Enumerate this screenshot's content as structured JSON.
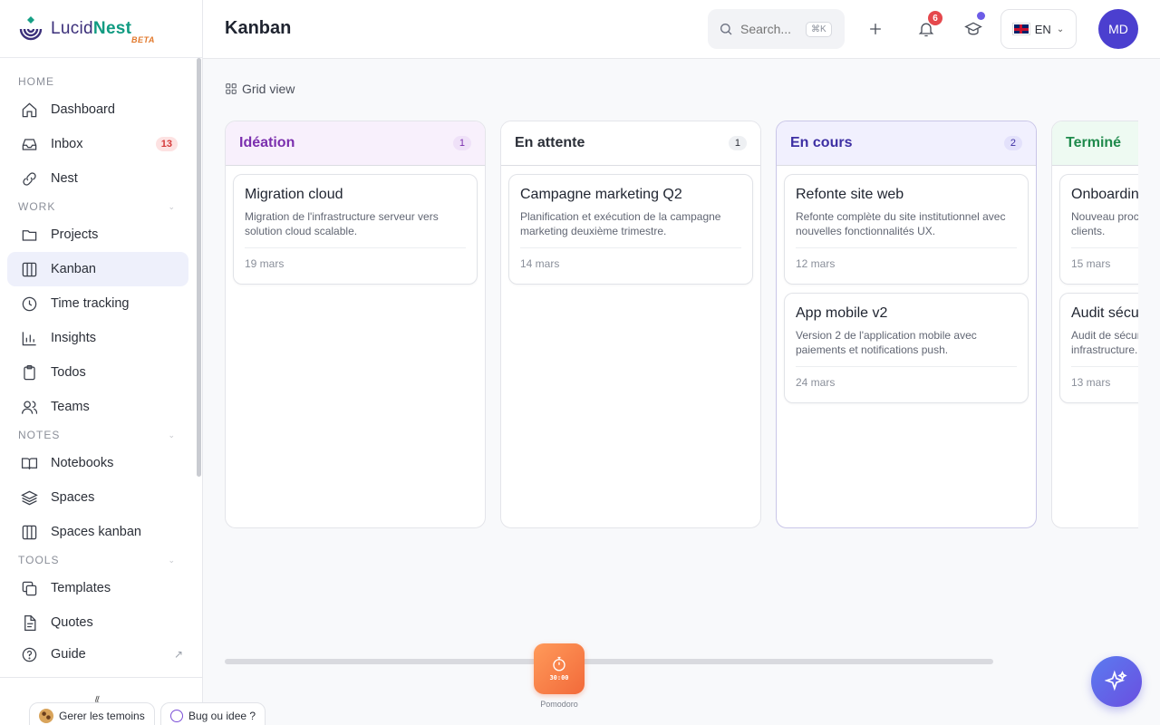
{
  "app": {
    "name_part1": "Lucid",
    "name_part2": "Nest",
    "beta": "BETA"
  },
  "header": {
    "title": "Kanban",
    "search_placeholder": "Search...",
    "search_shortcut": "⌘K",
    "notification_count": "6",
    "language": "EN",
    "avatar_initials": "MD"
  },
  "sidebar": {
    "sections": [
      {
        "label": "HOME"
      },
      {
        "label": "WORK"
      },
      {
        "label": "NOTES"
      },
      {
        "label": "TOOLS"
      }
    ],
    "items": [
      {
        "label": "Dashboard",
        "icon": "home-icon"
      },
      {
        "label": "Inbox",
        "icon": "inbox-icon",
        "badge": "13"
      },
      {
        "label": "Nest",
        "icon": "link-icon"
      },
      {
        "label": "Projects",
        "icon": "folder-icon"
      },
      {
        "label": "Kanban",
        "icon": "kanban-icon",
        "active": true
      },
      {
        "label": "Time tracking",
        "icon": "clock-icon"
      },
      {
        "label": "Insights",
        "icon": "chart-icon"
      },
      {
        "label": "Todos",
        "icon": "clipboard-icon"
      },
      {
        "label": "Teams",
        "icon": "users-icon"
      },
      {
        "label": "Notebooks",
        "icon": "book-icon"
      },
      {
        "label": "Spaces",
        "icon": "layers-icon"
      },
      {
        "label": "Spaces kanban",
        "icon": "kanban-icon"
      },
      {
        "label": "Templates",
        "icon": "copy-icon"
      },
      {
        "label": "Quotes",
        "icon": "file-icon"
      },
      {
        "label": "Guide",
        "icon": "help-icon"
      }
    ]
  },
  "main": {
    "view_toggle": "Grid view",
    "columns": [
      {
        "title": "Idéation",
        "count": "1",
        "color": "#7b2fae",
        "bg": "#f8f0fc",
        "count_bg": "#efe1f8",
        "cards": [
          {
            "title": "Migration cloud",
            "desc": "Migration de l'infrastructure serveur vers solution cloud scalable.",
            "date": "19 mars"
          }
        ]
      },
      {
        "title": "En attente",
        "count": "1",
        "color": "#2b2f38",
        "bg": "#ffffff",
        "count_bg": "#eef0f3",
        "cards": [
          {
            "title": "Campagne marketing Q2",
            "desc": "Planification et exécution de la campagne marketing deuxième trimestre.",
            "date": "14 mars"
          }
        ]
      },
      {
        "title": "En cours",
        "count": "2",
        "color": "#3d2fa3",
        "bg": "#f1f0fe",
        "count_bg": "#e3e1fb",
        "cards": [
          {
            "title": "Refonte site web",
            "desc": "Refonte complète du site institutionnel avec nouvelles fonctionnalités UX.",
            "date": "12 mars"
          },
          {
            "title": "App mobile v2",
            "desc": "Version 2 de l'application mobile avec paiements et notifications push.",
            "date": "24 mars"
          }
        ]
      },
      {
        "title": "Terminé",
        "count": "",
        "color": "#1f8a4c",
        "bg": "#eefaf2",
        "count_bg": "#dff3e6",
        "cards": [
          {
            "title": "Onboarding",
            "desc": "Nouveau processus pour les nouveaux clients.",
            "date": "15 mars"
          },
          {
            "title": "Audit sécurité",
            "desc": "Audit de sécurité des applications et infrastructure.",
            "date": "13 mars"
          }
        ]
      }
    ]
  },
  "footer": {
    "pomodoro_time": "30:00",
    "pomodoro_label": "Pomodoro",
    "cookies_label": "Gerer les temoins",
    "bug_label": "Bug ou idee ?"
  }
}
